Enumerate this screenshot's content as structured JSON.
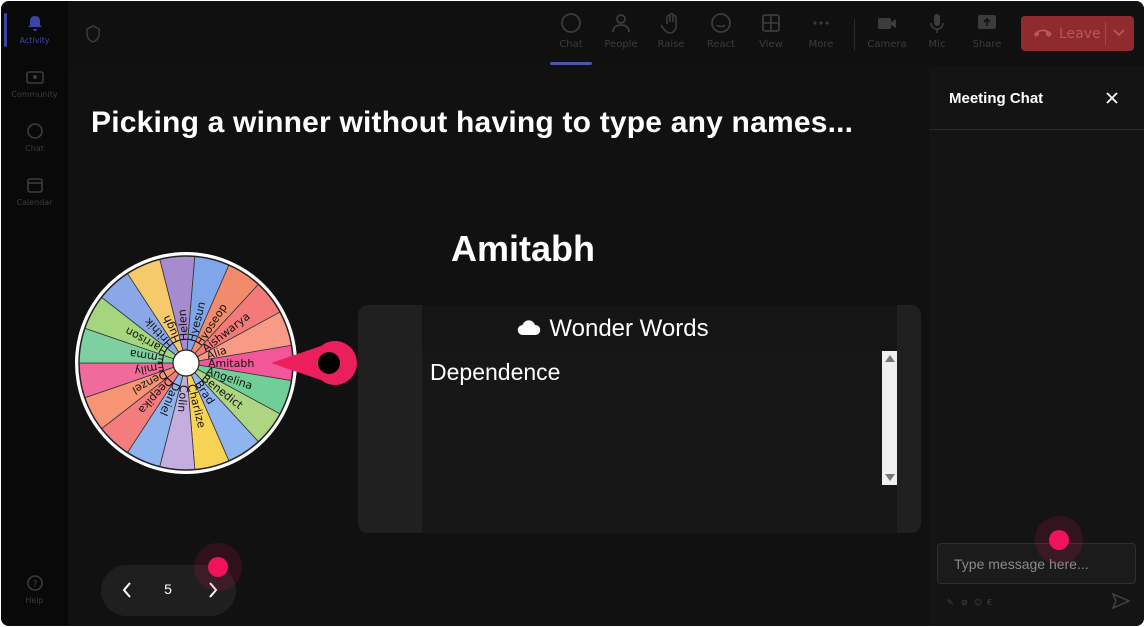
{
  "rail": {
    "items": [
      {
        "label": "Activity",
        "icon": "bell-icon"
      },
      {
        "label": "Community",
        "icon": "community-icon"
      },
      {
        "label": "Chat",
        "icon": "chat-icon"
      },
      {
        "label": "Calendar",
        "icon": "calendar-icon"
      }
    ],
    "help_label": "Help"
  },
  "toolbar": {
    "buttons": [
      {
        "label": "Chat",
        "icon": "chat-icon"
      },
      {
        "label": "People",
        "icon": "people-icon"
      },
      {
        "label": "Raise",
        "icon": "hand-icon"
      },
      {
        "label": "React",
        "icon": "smile-icon"
      },
      {
        "label": "View",
        "icon": "grid-icon"
      },
      {
        "label": "More",
        "icon": "more-icon"
      },
      {
        "label": "Camera",
        "icon": "camera-off-icon"
      },
      {
        "label": "Mic",
        "icon": "mic-icon"
      },
      {
        "label": "Share",
        "icon": "share-icon"
      }
    ],
    "leave_label": "Leave",
    "leave_color": "#8f2a2e"
  },
  "stage": {
    "title": "Picking a winner without having to type any names...",
    "winner": "Amitabh",
    "wheel": {
      "names": [
        "Helen",
        "Hyesun",
        "Hyoseop",
        "Aishwarya",
        "Alia",
        "Amitabh",
        "Angelina",
        "Benedict",
        "Brad",
        "Charlize",
        "Colin",
        "Daniel",
        "Deepika",
        "Denzel",
        "Emily",
        "Emma",
        "Harrison",
        "Hrithik",
        "Hugh"
      ],
      "colors": [
        "#a78bcf",
        "#7ea6e8",
        "#f28b6b",
        "#f47a7a",
        "#f79a86",
        "#f2579a",
        "#6fcf97",
        "#aed581",
        "#90b4f0",
        "#f7d354",
        "#c3aee0",
        "#8fb3ec",
        "#f57c7c",
        "#f79473",
        "#f06a9a",
        "#7ed0a0",
        "#a5d67e",
        "#8aa8e8",
        "#f6c96a"
      ],
      "pointer_color": "#ea1f5c"
    },
    "card": {
      "title": "Wonder Words",
      "icon": "cloud-icon",
      "text": "Dependence"
    },
    "pager": {
      "page": "5"
    }
  },
  "chat": {
    "title": "Meeting Chat",
    "input_placeholder": "Type message here..."
  },
  "colors": {
    "cursor": "#f0125a",
    "accent": "#4c55a8"
  }
}
